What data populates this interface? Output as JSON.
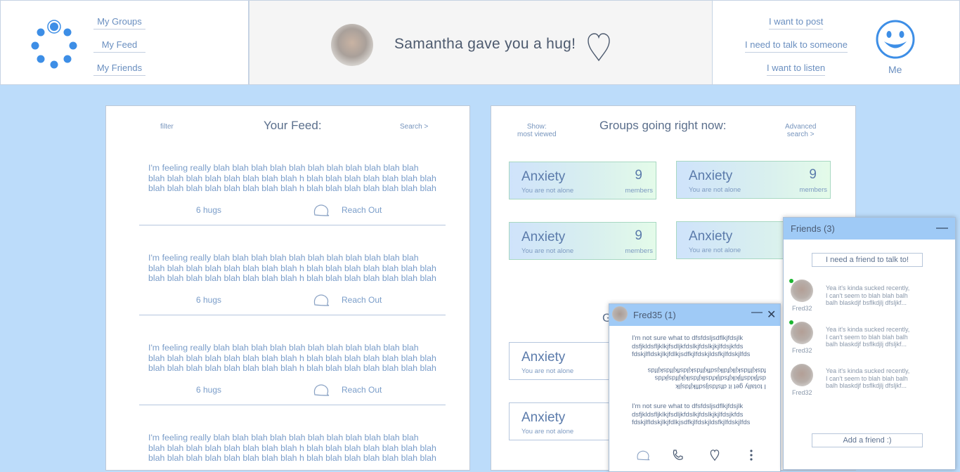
{
  "nav": {
    "left_links": [
      "My Groups",
      "My Feed",
      "My Friends"
    ],
    "right_links": [
      "I want to post",
      "I need to talk to someone",
      "I want to listen"
    ],
    "me_label": "Me"
  },
  "notification": {
    "text": "Samantha gave you a hug!"
  },
  "feed": {
    "filter": "filter",
    "title": "Your Feed:",
    "search": "Search >",
    "posts": [
      {
        "lines": [
          "I'm feeling really blah blah blah blah blah blah blah blah blah blah blah",
          "blah blah blah blah blah blah blah blah h blah blah blah blah blah blah blah",
          "blah blah blah blah blah blah blah blah h blah blah blah blah blah blah blah"
        ],
        "hugs": "6 hugs",
        "reach": "Reach Out"
      },
      {
        "lines": [
          "I'm feeling really blah blah blah blah blah blah blah blah blah blah blah",
          "blah blah blah blah blah blah blah blah h blah blah blah blah blah blah blah",
          "blah blah blah blah blah blah blah blah h blah blah blah blah blah blah blah"
        ],
        "hugs": "6 hugs",
        "reach": "Reach Out"
      },
      {
        "lines": [
          "I'm feeling really blah blah blah blah blah blah blah blah blah blah blah",
          "blah blah blah blah blah blah blah blah h blah blah blah blah blah blah blah",
          "blah blah blah blah blah blah blah blah h blah blah blah blah blah blah blah"
        ],
        "hugs": "6 hugs",
        "reach": "Reach Out"
      },
      {
        "lines": [
          "I'm feeling really blah blah blah blah blah blah blah blah blah blah blah",
          "blah blah blah blah blah blah blah blah h blah blah blah blah blah blah blah",
          "blah blah blah blah blah blah blah blah h blah blah blah blah blah blah blah"
        ]
      }
    ]
  },
  "groups": {
    "show_line1": "Show:",
    "show_line2": "most viewed",
    "title": "Groups going right now:",
    "advanced_line1": "Advanced",
    "advanced_line2": "search >",
    "cards": [
      {
        "name": "Anxiety",
        "sub": "You are not alone",
        "count": "9",
        "members": "members"
      },
      {
        "name": "Anxiety",
        "sub": "You are not alone",
        "count": "9",
        "members": "members"
      },
      {
        "name": "Anxiety",
        "sub": "You are not alone",
        "count": "9",
        "members": "members"
      },
      {
        "name": "Anxiety",
        "sub": "You are not alone"
      },
      {
        "name": "Anxiety",
        "sub": "You are not alone"
      },
      {
        "name": "Anxiety",
        "sub": "You are not alone"
      }
    ],
    "partial_heading": "G"
  },
  "chat": {
    "name": "Fred35 (1)",
    "messages": [
      [
        "I'm not sure what to dfsfdsljsdflkjfdsjlk",
        "dsfjkldsfljklkjfsdljkfdslkjfdslkjkjlfdsjkfds",
        "fdskjlfldskjlkjfdlkjsdfkjlfdskjldsfkjlfdskjlfds"
      ],
      [
        "I totally get it dfsfdsljsdflkjfdsjlk",
        "dsfjkldsfljklkjfsdljkfdslkjfdslkjkjlfdsjkfds",
        "fdskjlfldskjlkjfdlkjsdfkjlfdskjldsfkjlfdskjlfds"
      ],
      [
        "I'm not sure what to dfsfdsljsdflkjfdsjlk",
        "dsfjkldsfljklkjfsdljkfdslkjfdslkjkjlfdsjkfds",
        "fdskjlfldskjlkjfdlkjsdfkjlfdskjldsfkjlfdskjlfds"
      ]
    ]
  },
  "friends": {
    "title": "Friends (3)",
    "talk_button": "I need a friend to talk to!",
    "add_button": "Add a friend :)",
    "list": [
      {
        "name": "Fred32",
        "online": true,
        "lines": [
          "Yea it's kinda sucked recently,",
          "I can't seem to blah blah balh",
          "balh blaskdjf bsflkdjlj dfsljkf..."
        ]
      },
      {
        "name": "Fred32",
        "online": true,
        "lines": [
          "Yea it's kinda sucked recently,",
          "I can't seem to blah blah balh",
          "balh blaskdjf bsflkdjlj dfsljkf..."
        ]
      },
      {
        "name": "Fred32",
        "online": false,
        "lines": [
          "Yea it's kinda sucked recently,",
          "I can't seem to blah blah balh",
          "balh blaskdjf bsflkdjlj dfsljkf..."
        ]
      }
    ]
  },
  "colors": {
    "accent": "#3d8ee6",
    "background": "#bcdcfa",
    "header_blue": "#9fcaf6",
    "online": "#1db531"
  },
  "icons": [
    "loading-dots-icon",
    "heart-icon",
    "smiley-face-icon",
    "speech-bubble-icon",
    "phone-icon",
    "more-vertical-icon",
    "minimize-icon",
    "close-icon"
  ]
}
